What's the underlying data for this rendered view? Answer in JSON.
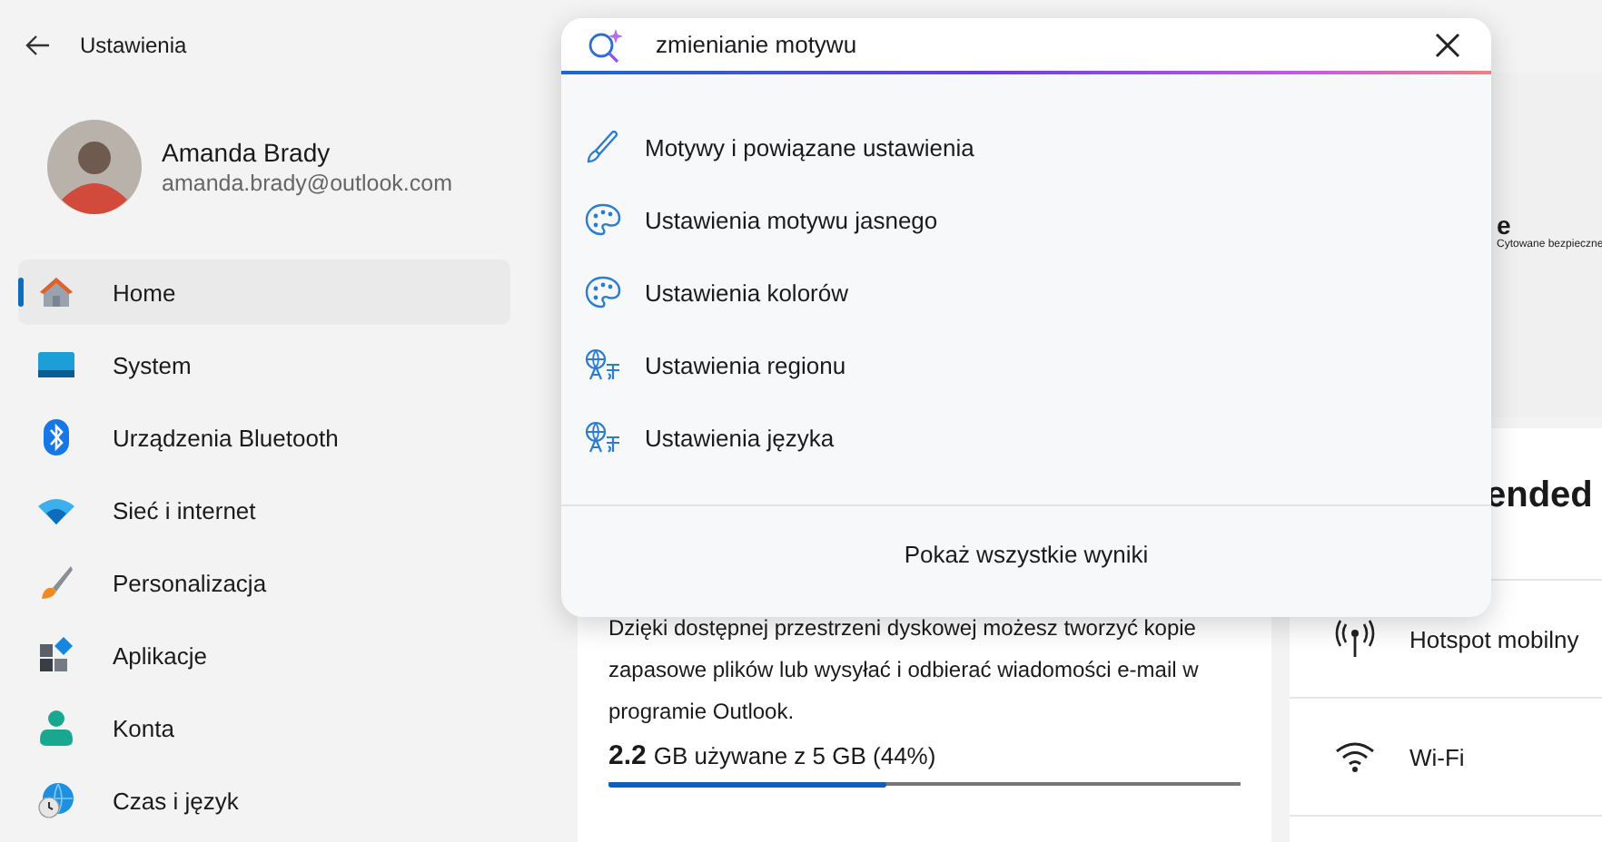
{
  "window": {
    "title": "Ustawienia"
  },
  "user": {
    "name": "Amanda Brady",
    "email": "amanda.brady@outlook.com"
  },
  "sidebar": {
    "items": [
      {
        "label": "Home",
        "kind": "home",
        "selected": true
      },
      {
        "label": "System",
        "kind": "monitor",
        "selected": false
      },
      {
        "label": "Urządzenia Bluetooth",
        "kind": "bluetooth",
        "selected": false
      },
      {
        "label": "Sieć i internet",
        "kind": "wifi",
        "selected": false
      },
      {
        "label": "Personalizacja",
        "kind": "brush",
        "selected": false
      },
      {
        "label": "Aplikacje",
        "kind": "apps",
        "selected": false
      },
      {
        "label": "Konta",
        "kind": "person",
        "selected": false
      },
      {
        "label": "Czas i język",
        "kind": "globe",
        "selected": false
      }
    ]
  },
  "search": {
    "value": "zmienianie motywu",
    "results": [
      {
        "label": "Motywy i powiązane ustawienia",
        "kind": "pen"
      },
      {
        "label": "Ustawienia motywu jasnego",
        "kind": "palette"
      },
      {
        "label": "Ustawienia kolorów",
        "kind": "palette"
      },
      {
        "label": "Ustawienia regionu",
        "kind": "language"
      },
      {
        "label": "Ustawienia języka",
        "kind": "language"
      }
    ],
    "show_all": "Pokaż wszystkie wyniki"
  },
  "storage_card": {
    "description": "Dzięki dostępnej przestrzeni dyskowej możesz tworzyć kopie zapasowe plików lub wysyłać i odbierać wiadomości e-mail w programie Outlook.",
    "used_amount": "2.2",
    "used_text": "GB używane z 5 GB (44%)",
    "level": 0.44
  },
  "side_card": {
    "title_fragment": "e",
    "caption_fragment": "Cytowane bezpieczne",
    "heading_fragment": "ended",
    "items": [
      {
        "label": "Hotspot mobilny",
        "kind": "hotspot"
      },
      {
        "label": "Wi-Fi",
        "kind": "wifi-line"
      }
    ]
  }
}
